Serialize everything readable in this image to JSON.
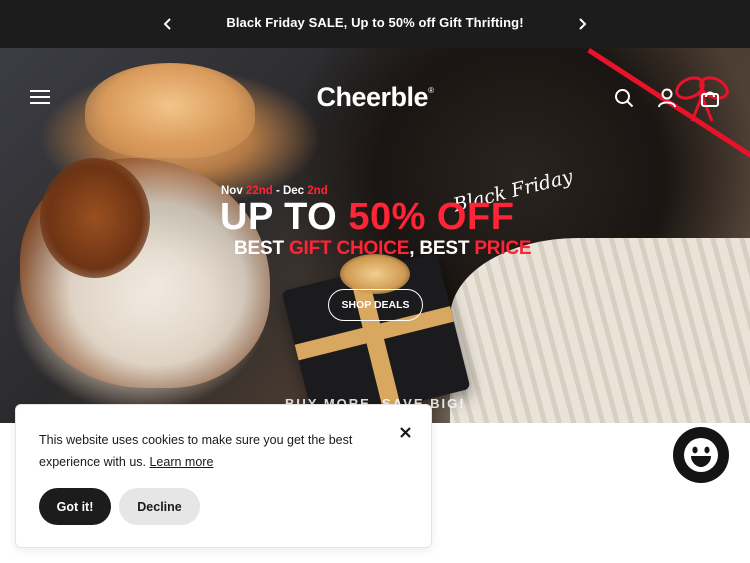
{
  "announcement": {
    "message": "Black Friday SALE, Up to 50% off Gift Thrifting!",
    "prev_icon": "chevron-left-icon",
    "next_icon": "chevron-right-icon"
  },
  "header": {
    "logo": "Cheerble",
    "logo_mark": "®",
    "menu_icon": "hamburger-menu-icon",
    "search_icon": "search-icon",
    "account_icon": "user-icon",
    "cart_icon": "shopping-bag-icon"
  },
  "hero": {
    "dates_start": "Nov ",
    "dates_start_day": "22nd",
    "dates_sep": " - Dec ",
    "dates_end_day": "2nd",
    "black_friday_script": "Black Friday",
    "headline_part1": "UP TO ",
    "headline_highlight": "50% OFF",
    "subline_part1": "BEST ",
    "subline_highlight1": "GIFT CHOICE",
    "subline_part2": ", BEST ",
    "subline_highlight2": "PRICE",
    "cta_label": "SHOP DEALS",
    "bottom_text": "BUY MORE, SAVE BIG!"
  },
  "cookie_banner": {
    "message": "This website uses cookies to make sure you get the best experience with us. ",
    "learn_more": "Learn more",
    "accept_label": "Got it!",
    "decline_label": "Decline",
    "close_icon": "close-icon"
  },
  "chat_widget": {
    "icon": "smiley-chat-icon"
  },
  "colors": {
    "accent_red": "#ff2436",
    "bar_dark": "#1c1c1c",
    "decline_bg": "#e6e6e6"
  }
}
